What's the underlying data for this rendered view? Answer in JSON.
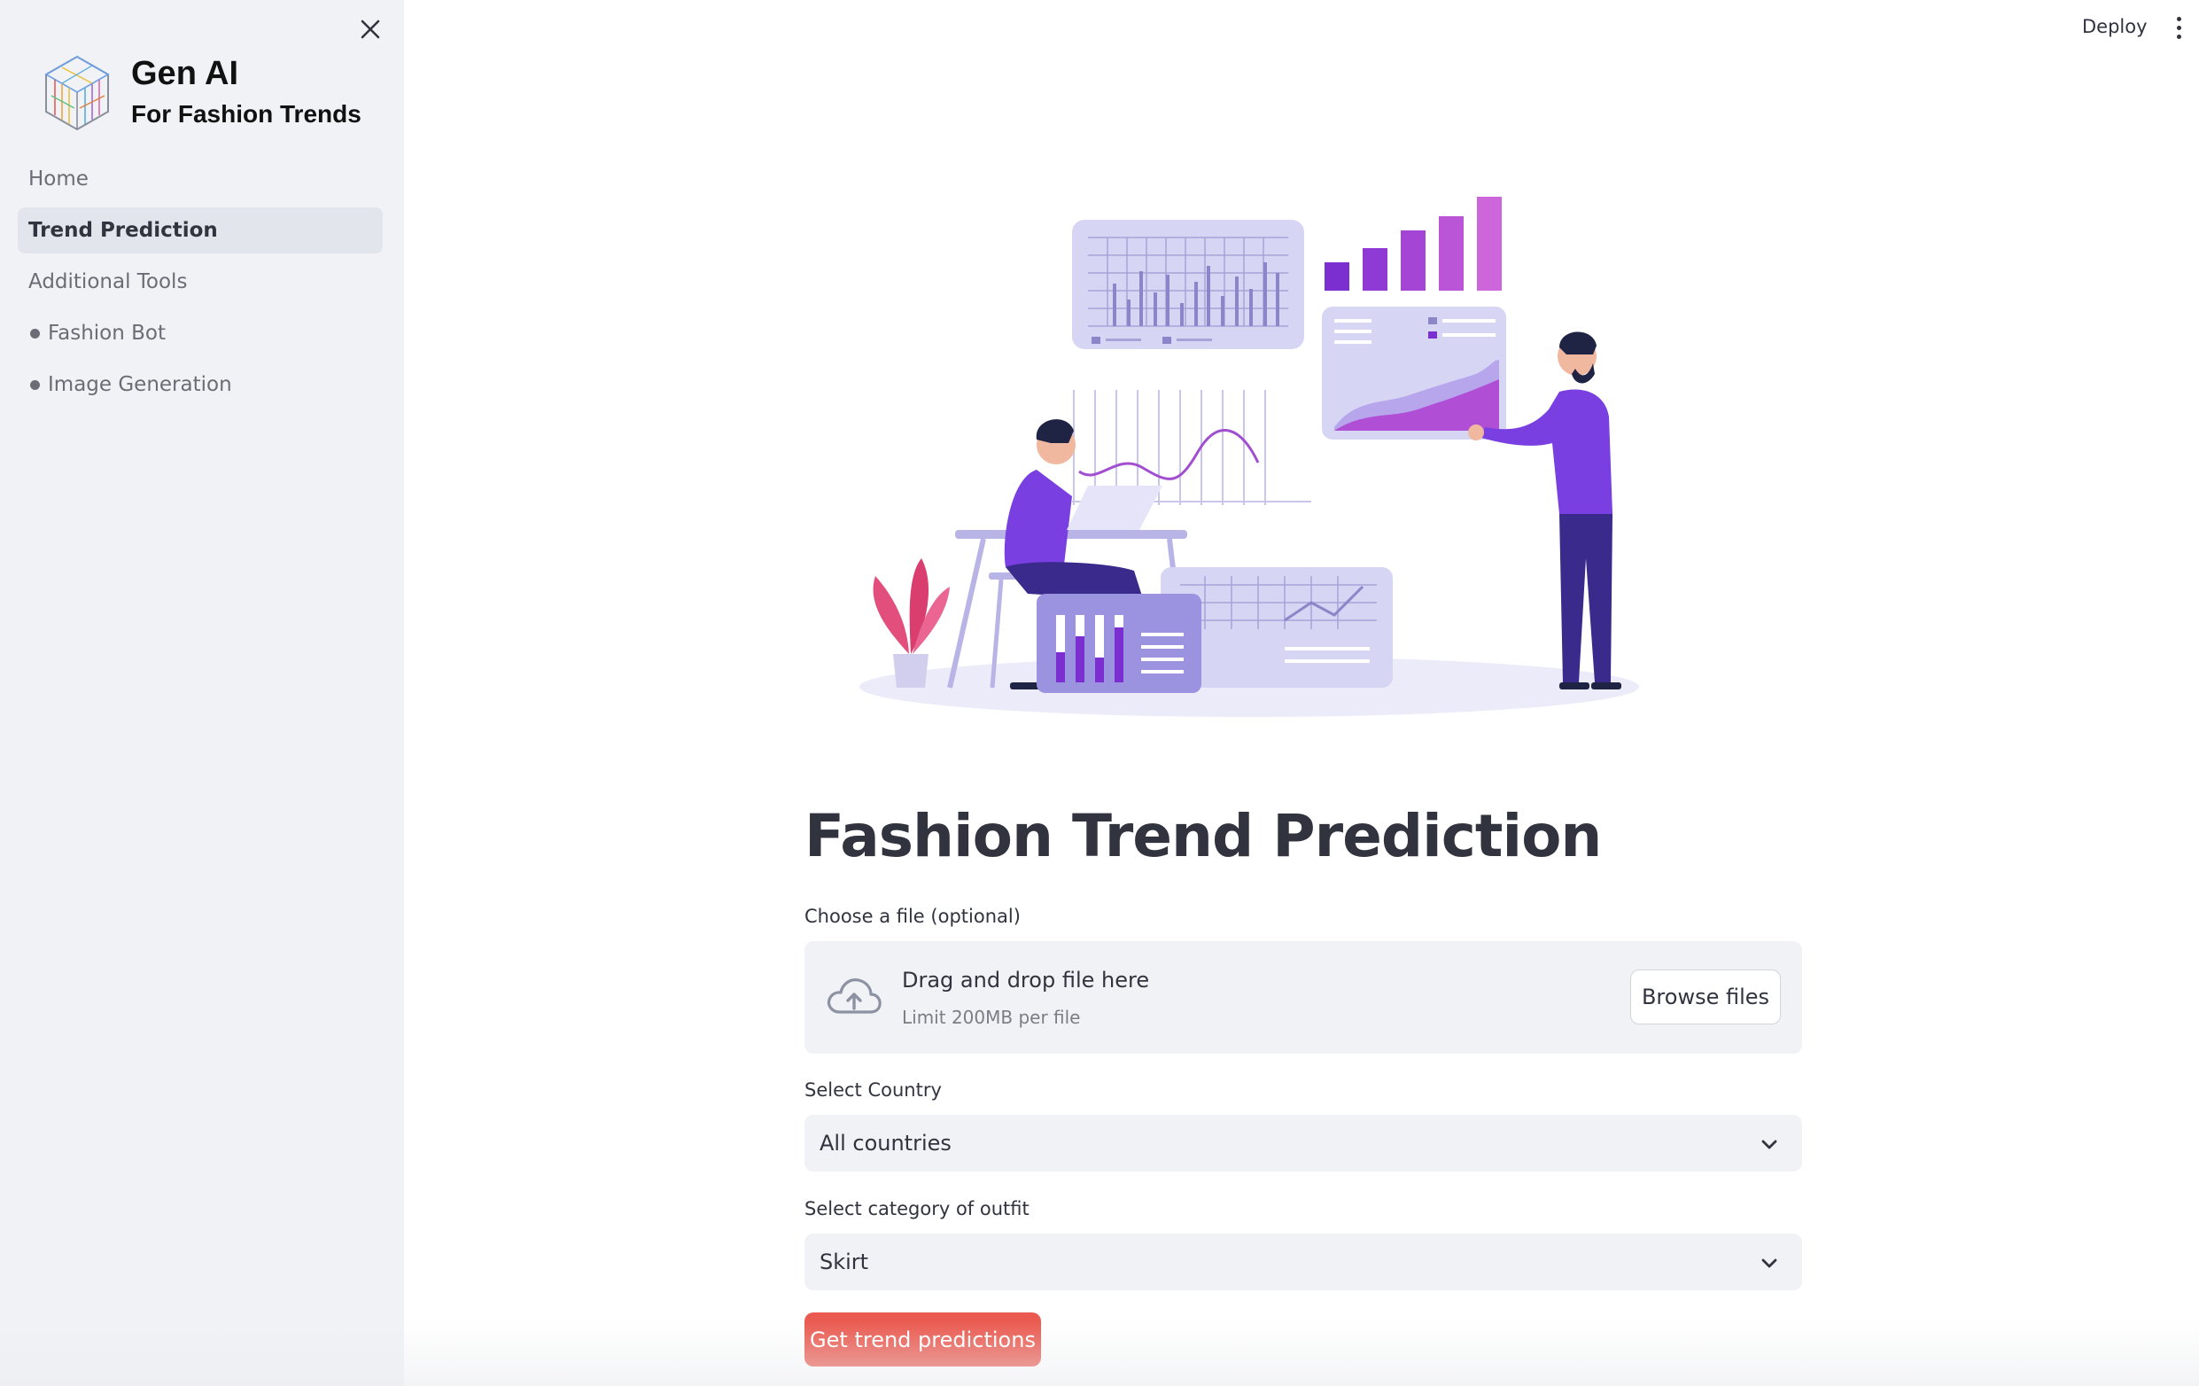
{
  "sidebar": {
    "brand": {
      "title": "Gen AI",
      "subtitle": "For Fashion Trends"
    },
    "items": [
      {
        "label": "Home",
        "active": false,
        "bullet": false
      },
      {
        "label": "Trend Prediction",
        "active": true,
        "bullet": false
      },
      {
        "label": "Additional Tools",
        "active": false,
        "bullet": false
      },
      {
        "label": "Fashion Bot",
        "active": false,
        "bullet": true
      },
      {
        "label": "Image Generation",
        "active": false,
        "bullet": true
      }
    ]
  },
  "header": {
    "deploy_label": "Deploy"
  },
  "main": {
    "title": "Fashion Trend Prediction",
    "uploader": {
      "label": "Choose a file (optional)",
      "drop_text": "Drag and drop file here",
      "limit_text": "Limit 200MB per file",
      "browse_label": "Browse files"
    },
    "country_select": {
      "label": "Select Country",
      "value": "All countries"
    },
    "category_select": {
      "label": "Select category of outfit",
      "value": "Skirt"
    },
    "submit_label": "Get trend predictions"
  },
  "colors": {
    "accent": "#ea5a50",
    "sidebar_bg": "#f0f2f6",
    "illustration_primary": "#7a3fe0",
    "illustration_accent": "#c86bd8"
  },
  "icons": [
    "close-icon",
    "kebab-menu-icon",
    "cloud-upload-icon",
    "chevron-down-icon",
    "cube-logo-icon"
  ]
}
